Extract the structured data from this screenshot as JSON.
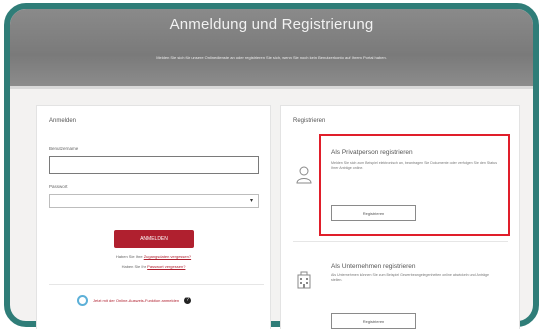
{
  "page": {
    "title": "Anmeldung und Registrierung",
    "subtitle": "Melden Sie sich für unsere Onlinedienste an oder registrieren Sie sich, wenn Sie noch kein Benutzerkonto auf Ihrem Portal haben."
  },
  "login": {
    "heading": "Anmelden",
    "username_label": "Benutzername",
    "username_value": "",
    "password_label": "Passwort",
    "password_value": "",
    "submit_label": "ANMELDEN",
    "forgot_text": "Haben Sie Ihre",
    "forgot_link": "Zugangsdaten vergessen?",
    "reset_text": "Haben Sie Ihr",
    "reset_link": "Passwort vergessen?",
    "alt_login_text": "Jetzt mit der Online-Ausweis-Funktion anmelden"
  },
  "register": {
    "heading": "Registrieren",
    "private": {
      "title": "Als Privatperson registrieren",
      "description": "Melden Sie sich zum Beispiel elektronisch an, beantragen Sie Dokumente oder verfolgen Sie den Status Ihrer Anträge online.",
      "button_label": "Registrieren"
    },
    "company": {
      "title": "Als Unternehmen registrieren",
      "description": "Als Unternehmen können Sie zum Beispiel Gewerbeangelegenheiten online abwickeln und Anträge stellen.",
      "button_label": "Registrieren"
    }
  },
  "icons": {
    "person": "person-icon",
    "building": "building-icon",
    "dropdown": "chevron-down-icon",
    "id_logo": "ausweis-logo-icon",
    "help": "help-icon"
  },
  "colors": {
    "frame_border": "#2f7d78",
    "primary_button": "#b0202f",
    "highlight": "#e01e2a"
  }
}
